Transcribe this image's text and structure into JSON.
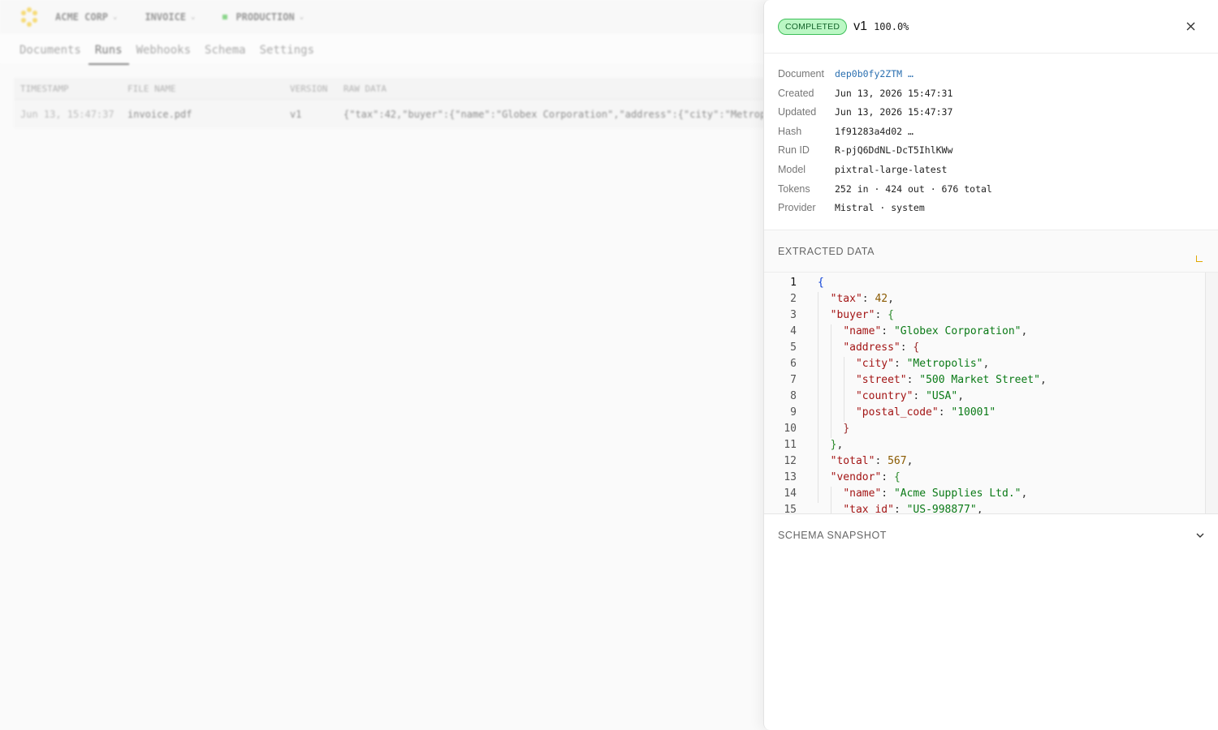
{
  "topbar": {
    "org": "ACME CORP",
    "doc_type": "INVOICE",
    "env": "PRODUCTION",
    "env_color": "#2eb82e",
    "brand_color": "#f4c20d"
  },
  "tabs": [
    "Documents",
    "Runs",
    "Webhooks",
    "Schema",
    "Settings"
  ],
  "active_tab": "Runs",
  "table": {
    "headers": [
      "TIMESTAMP",
      "FILE NAME",
      "VERSION",
      "RAW DATA"
    ],
    "rows": [
      {
        "timestamp": "Jun 13, 15:47:37",
        "file_name": "invoice.pdf",
        "version": "v1",
        "raw": "{\"tax\":42,\"buyer\":{\"name\":\"Globex Corporation\",\"address\":{\"city\":\"Metrop"
      }
    ]
  },
  "panel": {
    "status": "COMPLETED",
    "status_color": "#3fbf5a",
    "version": "v1",
    "percent": "100.0%",
    "close_icon": "close-icon",
    "meta": [
      {
        "label": "Document",
        "value": "dep0b0fy2ZTM …",
        "link": true
      },
      {
        "label": "Created",
        "value": "Jun 13, 2026 15:47:31"
      },
      {
        "label": "Updated",
        "value": "Jun 13, 2026 15:47:37"
      },
      {
        "label": "Hash",
        "value": "1f91283a4d02 …"
      },
      {
        "label": "Run ID",
        "value": "R-pjQ6DdNL-DcT5IhlKWw"
      },
      {
        "label": "Model",
        "value": "pixtral-large-latest"
      },
      {
        "label": "Tokens",
        "value": "252 in · 424 out · 676 total"
      },
      {
        "label": "Provider",
        "value": "Mistral · system"
      }
    ],
    "extracted_title": "EXTRACTED DATA",
    "schema_title": "SCHEMA SNAPSHOT",
    "code_lines": [
      "{",
      "  \"tax\": 42,",
      "  \"buyer\": {",
      "    \"name\": \"Globex Corporation\",",
      "    \"address\": {",
      "      \"city\": \"Metropolis\",",
      "      \"street\": \"500 Market Street\",",
      "      \"country\": \"USA\",",
      "      \"postal_code\": \"10001\"",
      "    }",
      "  },",
      "  \"total\": 567,",
      "  \"vendor\": {",
      "    \"name\": \"Acme Supplies Ltd.\",",
      "    \"tax_id\": \"US-998877\","
    ]
  }
}
